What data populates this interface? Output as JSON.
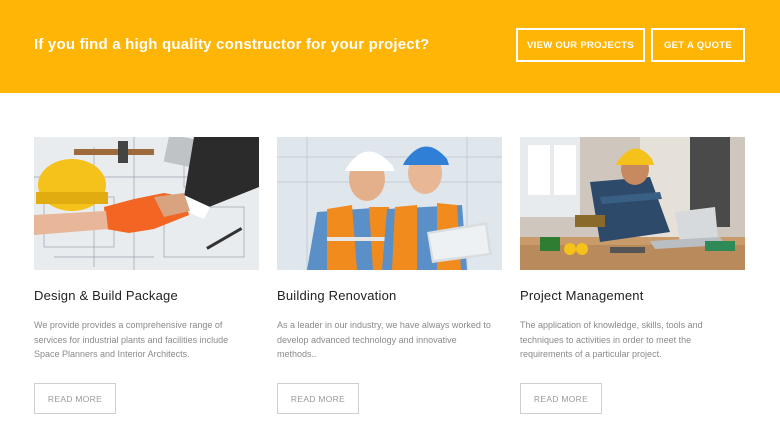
{
  "banner": {
    "text": "If you find a high quality constructor for your project?",
    "view_projects_label": "VIEW OUR PROJECTS",
    "quote_label": "GET A QUOTE",
    "background_color": "#ffb506"
  },
  "cards": [
    {
      "title": "Design  & Build Package",
      "text_lines": [
        "We provide  provides a comprehensive range of",
        "services for industrial plants and facilities include",
        "Space Planners and Interior Architects."
      ],
      "button_label": "READ MORE",
      "image": "handshake-blueprint-photo"
    },
    {
      "title": "Building Renovation",
      "text_lines": [
        "As a leader in our industry, we have always worked to",
        "develop advanced technology and innovative",
        "methods.."
      ],
      "button_label": "READ MORE",
      "image": "engineers-laptop-photo"
    },
    {
      "title": "Project Management",
      "text_lines": [
        "The application of knowledge, skills, tools and",
        "techniques to activities in order to meet the",
        "requirements of a particular project."
      ],
      "button_label": "READ MORE",
      "image": "worker-at-desk-photo"
    }
  ]
}
